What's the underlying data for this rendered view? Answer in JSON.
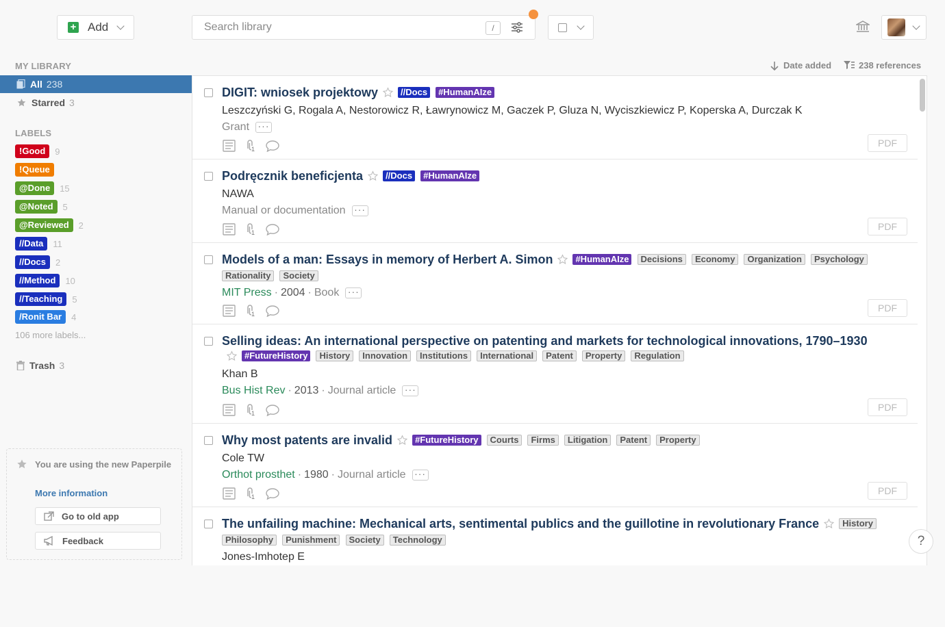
{
  "toolbar": {
    "add_label": "Add",
    "search_placeholder": "Search library",
    "search_shortcut": "/"
  },
  "sidebar": {
    "my_library_heading": "MY LIBRARY",
    "all": {
      "label": "All",
      "count": "238"
    },
    "starred": {
      "label": "Starred",
      "count": "3"
    },
    "labels_heading": "LABELS",
    "labels": [
      {
        "name": "!Good",
        "count": "9",
        "color": "#d0021b"
      },
      {
        "name": "!Queue",
        "count": "",
        "color": "#f07d00"
      },
      {
        "name": "@Done",
        "count": "15",
        "color": "#5a9e2a"
      },
      {
        "name": "@Noted",
        "count": "5",
        "color": "#5a9e2a"
      },
      {
        "name": "@Reviewed",
        "count": "2",
        "color": "#5a9e2a"
      },
      {
        "name": "//Data",
        "count": "11",
        "color": "#1a2fbd"
      },
      {
        "name": "//Docs",
        "count": "2",
        "color": "#1a2fbd"
      },
      {
        "name": "//Method",
        "count": "10",
        "color": "#1a2fbd"
      },
      {
        "name": "//Teaching",
        "count": "5",
        "color": "#1a2fbd"
      },
      {
        "name": "/Ronit Bar",
        "count": "4",
        "color": "#2a7de1"
      }
    ],
    "more_labels": "106 more labels...",
    "trash": {
      "label": "Trash",
      "count": "3"
    },
    "notice": {
      "message": "You are using the new Paperpile",
      "more_info": "More information",
      "old_app": "Go to old app",
      "feedback": "Feedback"
    }
  },
  "list_header": {
    "sort_label": "Date added",
    "ref_count": "238 references"
  },
  "items": [
    {
      "title": "DIGIT: wniosek projektowy",
      "tags": [
        {
          "t": "//Docs",
          "c": "blue"
        },
        {
          "t": "#HumanAIze",
          "c": "purple"
        }
      ],
      "authors": "Leszczyński G, Rogala A, Nestorowicz R, Ławrynowicz M, Gaczek P, Gluza N, Wyciszkiewicz P, Koperska A, Durczak K",
      "journal": "",
      "year": "",
      "type": "Grant",
      "attach_count": "1"
    },
    {
      "title": "Podręcznik beneficjenta",
      "tags": [
        {
          "t": "//Docs",
          "c": "blue"
        },
        {
          "t": "#HumanAIze",
          "c": "purple"
        }
      ],
      "authors": "NAWA",
      "journal": "",
      "year": "",
      "type": "Manual or documentation",
      "attach_count": "1"
    },
    {
      "title": "Models of a man: Essays in memory of Herbert A. Simon",
      "tags": [
        {
          "t": "#HumanAIze",
          "c": "purple"
        },
        {
          "t": "Decisions",
          "c": "grey"
        },
        {
          "t": "Economy",
          "c": "grey"
        },
        {
          "t": "Organization",
          "c": "grey"
        },
        {
          "t": "Psychology",
          "c": "grey"
        },
        {
          "t": "Rationality",
          "c": "grey"
        },
        {
          "t": "Society",
          "c": "grey"
        }
      ],
      "authors": "",
      "journal": "MIT Press",
      "year": "2004",
      "type": "Book",
      "attach_count": "1"
    },
    {
      "title": "Selling ideas: An international perspective on patenting and markets for technological innovations, 1790–1930",
      "tags": [
        {
          "t": "#FutureHistory",
          "c": "purple"
        },
        {
          "t": "History",
          "c": "grey"
        },
        {
          "t": "Innovation",
          "c": "grey"
        },
        {
          "t": "Institutions",
          "c": "grey"
        },
        {
          "t": "International",
          "c": "grey"
        },
        {
          "t": "Patent",
          "c": "grey"
        },
        {
          "t": "Property",
          "c": "grey"
        },
        {
          "t": "Regulation",
          "c": "grey"
        }
      ],
      "authors": "Khan B",
      "journal": "Bus Hist Rev",
      "year": "2013",
      "type": "Journal article",
      "attach_count": "1"
    },
    {
      "title": "Why most patents are invalid",
      "tags": [
        {
          "t": "#FutureHistory",
          "c": "purple"
        },
        {
          "t": "Courts",
          "c": "grey"
        },
        {
          "t": "Firms",
          "c": "grey"
        },
        {
          "t": "Litigation",
          "c": "grey"
        },
        {
          "t": "Patent",
          "c": "grey"
        },
        {
          "t": "Property",
          "c": "grey"
        }
      ],
      "authors": "Cole TW",
      "journal": "Orthot prosthet",
      "year": "1980",
      "type": "Journal article",
      "attach_count": "1"
    },
    {
      "title": "The unfailing machine: Mechanical arts, sentimental publics and the guillotine in revolutionary France",
      "tags": [
        {
          "t": "History",
          "c": "grey"
        },
        {
          "t": "Philosophy",
          "c": "grey"
        },
        {
          "t": "Punishment",
          "c": "grey"
        },
        {
          "t": "Society",
          "c": "grey"
        },
        {
          "t": "Technology",
          "c": "grey"
        }
      ],
      "authors": "Jones-Imhotep E",
      "journal": "",
      "year": "",
      "type": "",
      "attach_count": "1"
    }
  ],
  "pdf_label": "PDF",
  "help_label": "?"
}
